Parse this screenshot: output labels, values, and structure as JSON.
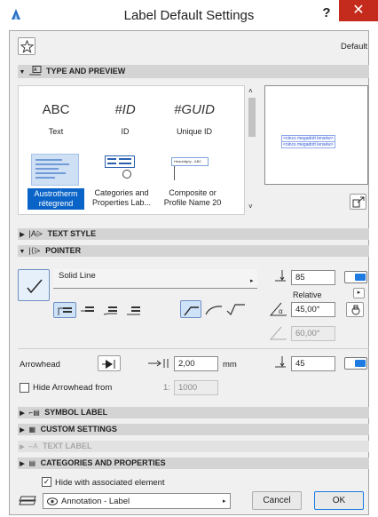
{
  "window": {
    "title": "Label Default Settings",
    "help_label": "?",
    "close_label": "✕"
  },
  "header": {
    "favorites_icon": "star-icon",
    "default_label": "Default"
  },
  "type_and_preview": {
    "section_title": "TYPE AND PREVIEW",
    "items": [
      {
        "glyph": "ABC",
        "label": "Text"
      },
      {
        "glyph": "#ID",
        "label": "ID"
      },
      {
        "glyph": "#GUID",
        "label": "Unique ID"
      },
      {
        "label_line1": "Austrotherm",
        "label_line2": "rétegrend",
        "selected": true
      },
      {
        "label_line1": "Categories and",
        "label_line2": "Properties Lab..."
      },
      {
        "thumb_text": "Headofgrty - ABC",
        "label_line1": "Composite or",
        "label_line2": "Profile Name 20"
      }
    ],
    "preview_line1": "<nincs megadott lenséw>",
    "preview_line2": "<nincs megadott lenséw>"
  },
  "text_style": {
    "section_title": "TEXT STYLE"
  },
  "pointer": {
    "section_title": "POINTER",
    "line_type": "Solid Line",
    "pen_value": "85",
    "relative_label": "Relative",
    "angle_value": "45,00°",
    "angle2_value": "60,00°"
  },
  "arrowhead": {
    "label": "Arrowhead",
    "size_value": "2,00",
    "size_unit": "mm",
    "pen_value": "45",
    "hide_from_label": "Hide Arrowhead from",
    "hide_from_scale_prefix": "1:",
    "hide_from_scale_value": "1000"
  },
  "sections": {
    "symbol_label": "SYMBOL LABEL",
    "custom_settings": "CUSTOM SETTINGS",
    "text_label": "TEXT LABEL",
    "categories": "CATEGORIES AND PROPERTIES"
  },
  "footer": {
    "hide_with_element_label": "Hide with associated element",
    "hide_with_element_checked": true,
    "layer_value": "Annotation - Label",
    "cancel_label": "Cancel",
    "ok_label": "OK"
  },
  "colors": {
    "accent": "#1d7be1",
    "selection": "#0a64c8",
    "close": "#c42b1c"
  }
}
